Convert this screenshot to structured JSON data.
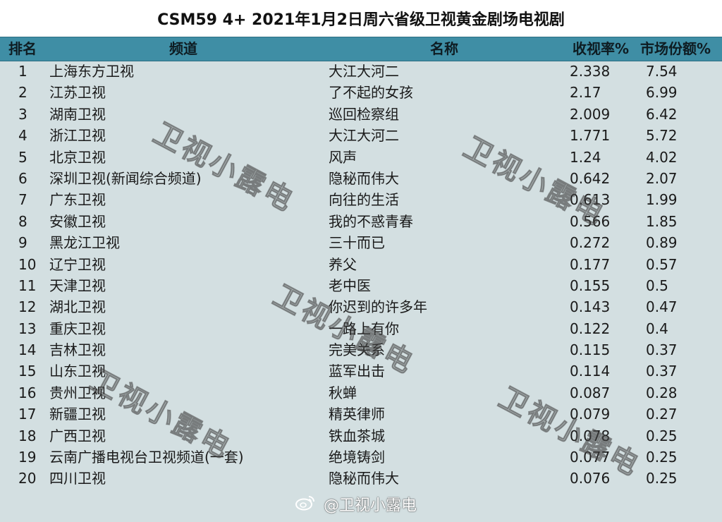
{
  "title": "CSM59 4+ 2021年1月2日周六省级卫视黄金剧场电视剧",
  "headers": {
    "rank": "排名",
    "channel": "频道",
    "name": "名称",
    "rating": "收视率%",
    "share": "市场份额%"
  },
  "rows": [
    {
      "rank": "1",
      "channel": "上海东方卫视",
      "name": "大江大河二",
      "rating": "2.338",
      "share": "7.54"
    },
    {
      "rank": "2",
      "channel": "江苏卫视",
      "name": "了不起的女孩",
      "rating": "2.17",
      "share": "6.99"
    },
    {
      "rank": "3",
      "channel": "湖南卫视",
      "name": "巡回检察组",
      "rating": "2.009",
      "share": "6.42"
    },
    {
      "rank": "4",
      "channel": "浙江卫视",
      "name": "大江大河二",
      "rating": "1.771",
      "share": "5.72"
    },
    {
      "rank": "5",
      "channel": "北京卫视",
      "name": "风声",
      "rating": "1.24",
      "share": "4.02"
    },
    {
      "rank": "6",
      "channel": "深圳卫视(新闻综合频道)",
      "name": "隐秘而伟大",
      "rating": "0.642",
      "share": "2.07"
    },
    {
      "rank": "7",
      "channel": "广东卫视",
      "name": "向往的生活",
      "rating": "0.613",
      "share": "1.99"
    },
    {
      "rank": "8",
      "channel": "安徽卫视",
      "name": "我的不惑青春",
      "rating": "0.566",
      "share": "1.85"
    },
    {
      "rank": "9",
      "channel": "黑龙江卫视",
      "name": "三十而已",
      "rating": "0.272",
      "share": "0.89"
    },
    {
      "rank": "10",
      "channel": "辽宁卫视",
      "name": "养父",
      "rating": "0.177",
      "share": "0.57"
    },
    {
      "rank": "11",
      "channel": "天津卫视",
      "name": "老中医",
      "rating": "0.155",
      "share": "0.5"
    },
    {
      "rank": "12",
      "channel": "湖北卫视",
      "name": "你迟到的许多年",
      "rating": "0.143",
      "share": "0.47"
    },
    {
      "rank": "13",
      "channel": "重庆卫视",
      "name": "一路上有你",
      "rating": "0.122",
      "share": "0.4"
    },
    {
      "rank": "14",
      "channel": "吉林卫视",
      "name": "完美关系",
      "rating": "0.115",
      "share": "0.37"
    },
    {
      "rank": "15",
      "channel": "山东卫视",
      "name": "蓝军出击",
      "rating": "0.114",
      "share": "0.37"
    },
    {
      "rank": "16",
      "channel": "贵州卫视",
      "name": "秋蝉",
      "rating": "0.087",
      "share": "0.28"
    },
    {
      "rank": "17",
      "channel": "新疆卫视",
      "name": "精英律师",
      "rating": "0.079",
      "share": "0.27"
    },
    {
      "rank": "18",
      "channel": "广西卫视",
      "name": "铁血茶城",
      "rating": "0.078",
      "share": "0.25"
    },
    {
      "rank": "19",
      "channel": "云南广播电视台卫视频道(一套)",
      "name": "绝境铸剑",
      "rating": "0.077",
      "share": "0.25"
    },
    {
      "rank": "20",
      "channel": "四川卫视",
      "name": "隐秘而伟大",
      "rating": "0.076",
      "share": "0.25"
    }
  ],
  "watermark": "卫视小露电",
  "weibo_handle": "@卫视小露电",
  "colors": {
    "header_bg": "#3f8ea5",
    "body_bg": "#d3dfe1"
  },
  "icons": {
    "weibo": "weibo-logo-icon"
  }
}
